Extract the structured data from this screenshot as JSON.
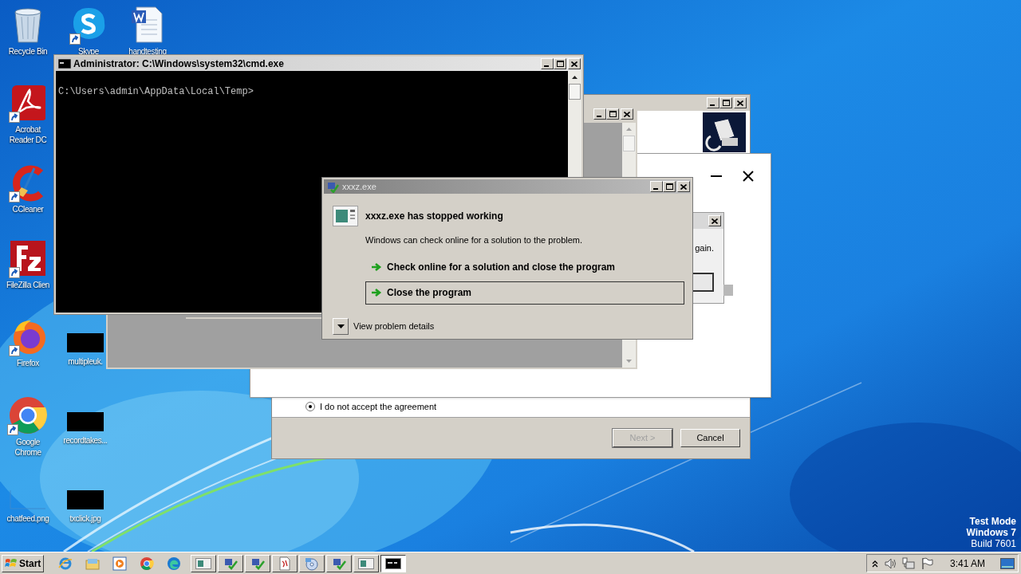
{
  "desktop_icons": [
    {
      "label": "Recycle Bin",
      "kind": "recycle",
      "shortcut": false
    },
    {
      "label": "Skype",
      "kind": "skype",
      "shortcut": true
    },
    {
      "label": "handtesting",
      "kind": "word",
      "shortcut": false
    },
    {
      "label": "Acrobat Reader DC",
      "kind": "acrobat",
      "shortcut": true
    },
    {
      "label": "CCleaner",
      "kind": "ccleaner",
      "shortcut": true
    },
    {
      "label": "FileZilla Clien",
      "kind": "filezilla",
      "shortcut": true
    },
    {
      "label": "Firefox",
      "kind": "firefox",
      "shortcut": true
    },
    {
      "label": "multipleuk.",
      "kind": "thumbnail",
      "shortcut": false
    },
    {
      "label": "Google Chrome",
      "kind": "chrome",
      "shortcut": true
    },
    {
      "label": "recordtakes...",
      "kind": "thumbnail",
      "shortcut": false
    },
    {
      "label": "chatfeed.png",
      "kind": "blank",
      "shortcut": false
    },
    {
      "label": "txclick.jpg",
      "kind": "thumbnail",
      "shortcut": false
    }
  ],
  "installer_window": {
    "radio": {
      "label": "I do not accept the agreement",
      "selected": true
    },
    "buttons": [
      {
        "label": "Next >",
        "disabled": true
      },
      {
        "label": "Cancel",
        "disabled": false
      }
    ]
  },
  "message_window": {
    "text": "gain."
  },
  "cmd_window": {
    "title": "Administrator: C:\\Windows\\system32\\cmd.exe",
    "prompt": "C:\\Users\\admin\\AppData\\Local\\Temp>"
  },
  "error_dialog": {
    "title": "xxxz.exe",
    "heading": "xxxz.exe has stopped working",
    "message": "Windows can check online for a solution to the problem.",
    "options": [
      {
        "label": "Check online for a solution and close the program",
        "selected": false
      },
      {
        "label": "Close the program",
        "selected": true
      }
    ],
    "details_label": "View problem details"
  },
  "taskbar": {
    "start_label": "Start",
    "quick_launch": [
      {
        "kind": "ie"
      },
      {
        "kind": "explorer"
      },
      {
        "kind": "media"
      },
      {
        "kind": "chrome"
      },
      {
        "kind": "edge"
      }
    ],
    "tasks": [
      {
        "kind": "window",
        "selected": false
      },
      {
        "kind": "app",
        "selected": false
      },
      {
        "kind": "app",
        "selected": false
      },
      {
        "kind": "setup",
        "selected": false
      },
      {
        "kind": "disc",
        "selected": false
      },
      {
        "kind": "app",
        "selected": false
      },
      {
        "kind": "window",
        "selected": false
      },
      {
        "kind": "cmd",
        "selected": true
      }
    ],
    "clock": "3:41 AM"
  },
  "os_notice": [
    {
      "text": "Test Mode",
      "bold": true
    },
    {
      "text": "Windows 7",
      "bold": true
    },
    {
      "text": "Build 7601",
      "bold": false
    }
  ]
}
